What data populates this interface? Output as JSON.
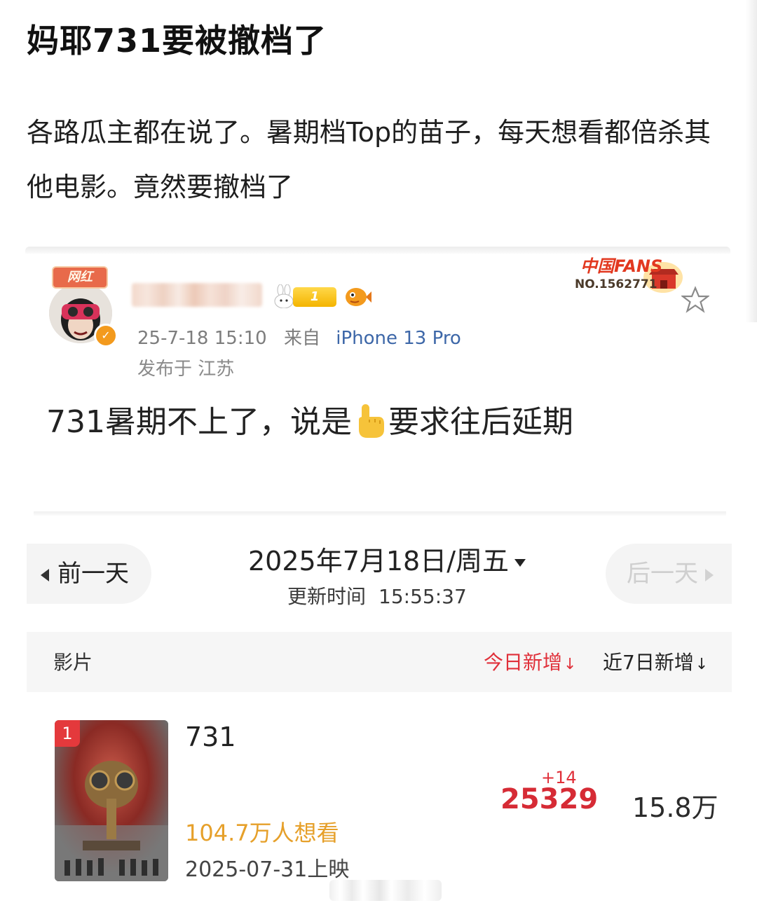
{
  "post": {
    "title": "妈耶731要被撤档了",
    "body": "各路瓜主都在说了。暑期档Top的苗子，每天想看都倍杀其他电影。竟然要撤档了"
  },
  "weibo_card": {
    "avatar_badge": "网红",
    "level": "1",
    "timestamp": "25-7-18 15:10",
    "from_label": "来自",
    "device": "iPhone 13 Pro",
    "location": "发布于 江苏",
    "fans_badge_title": "中国FANS",
    "fans_badge_no": "NO.1562771",
    "quote_before": "731暑期不上了，说是",
    "quote_after": "要求往后延期"
  },
  "box_office": {
    "prev_label": "前一天",
    "next_label": "后一天",
    "date": "2025年7月18日/周五",
    "update_label": "更新时间",
    "update_time": "15:55:37",
    "columns": {
      "film": "影片",
      "today": "今日新增",
      "week": "近7日新增"
    },
    "rows": [
      {
        "rank": "1",
        "name": "731",
        "want": "104.7万人想看",
        "release": "2025-07-31上映",
        "delta": "+14",
        "today": "25329",
        "week": "15.8万"
      }
    ]
  },
  "colors": {
    "accent_red": "#e0303a",
    "want_orange": "#e6a02a",
    "device_blue": "#3d67a8"
  }
}
